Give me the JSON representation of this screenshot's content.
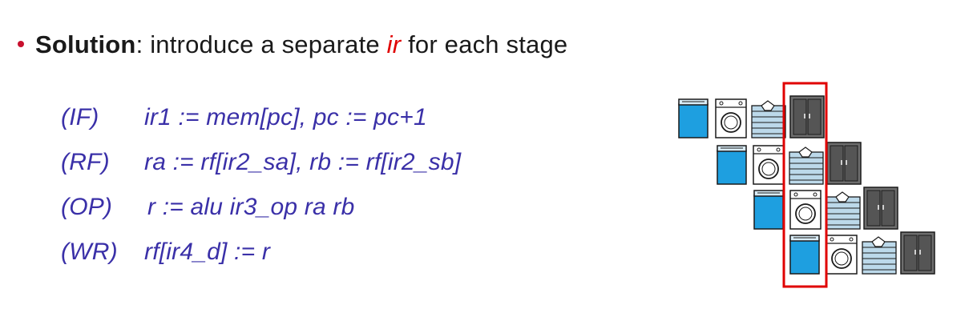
{
  "slide": {
    "bullet": {
      "term": "Solution",
      "text_before": ": introduce a separate ",
      "highlight": "ir",
      "text_after": " for each stage"
    },
    "rows": [
      {
        "stage": "(IF)",
        "expr": "ir1 := mem[pc], pc := pc+1"
      },
      {
        "stage": "(RF)",
        "expr": "ra := rf[ir2_sa], rb := rf[ir2_sb]"
      },
      {
        "stage": "(OP)",
        "expr": "r := alu ir3_op ra rb"
      },
      {
        "stage": "(WR)",
        "expr": "rf[ir4_d] := r"
      }
    ]
  },
  "pipeline_diagram": {
    "rows": [
      [
        "washer-icon",
        "dryer-icon",
        "folded-clothes-icon",
        "closet-icon"
      ],
      [
        "washer-icon",
        "dryer-icon",
        "folded-clothes-icon",
        "closet-icon"
      ],
      [
        "washer-icon",
        "dryer-icon",
        "folded-clothes-icon",
        "closet-icon"
      ],
      [
        "washer-icon",
        "dryer-icon",
        "folded-clothes-icon",
        "closet-icon"
      ]
    ],
    "highlight_column": "current-cycle"
  },
  "colors": {
    "bullet_dot": "#c8102e",
    "text_dark": "#1a1a1a",
    "highlight_red": "#e00000",
    "code_blue": "#3a30a8",
    "washer_blue": "#1e9fe0",
    "closet_gray": "#6e6e6e",
    "frame_red": "#e00000"
  }
}
